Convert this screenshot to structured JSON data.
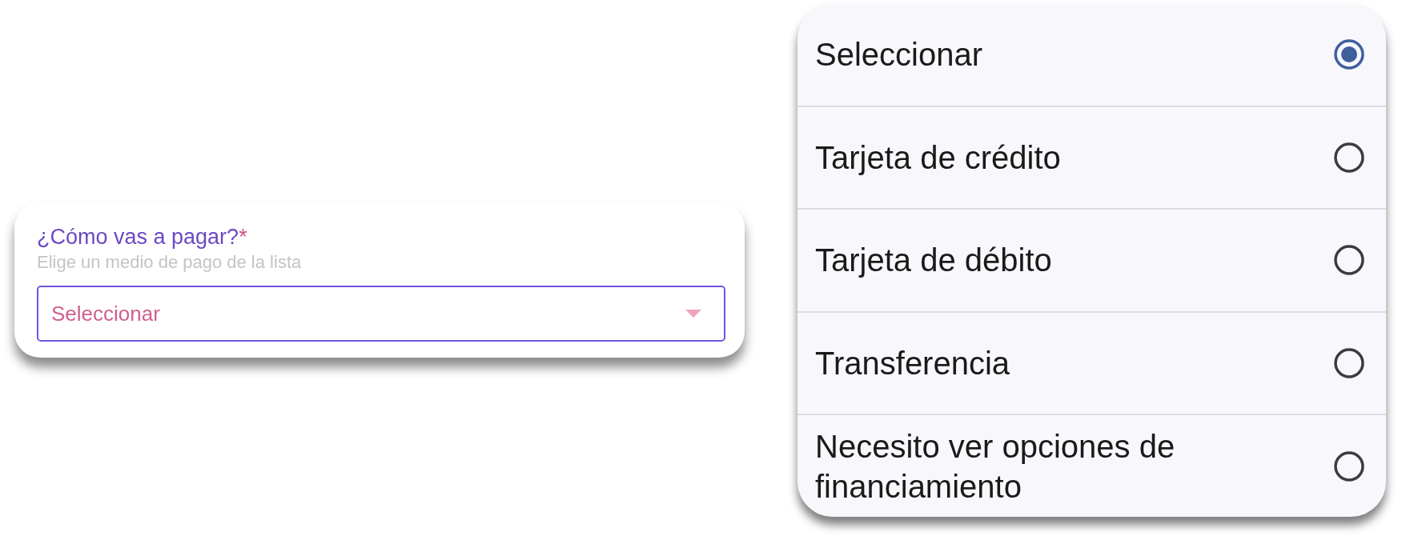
{
  "payment_field": {
    "label": "¿Cómo vas a pagar?",
    "required_mark": "*",
    "hint": "Elige un medio de pago de la lista",
    "select": {
      "value": "Seleccionar"
    }
  },
  "options_list": {
    "options": [
      {
        "label": "Seleccionar",
        "selected": true
      },
      {
        "label": "Tarjeta de crédito",
        "selected": false
      },
      {
        "label": "Tarjeta de débito",
        "selected": false
      },
      {
        "label": "Transferencia",
        "selected": false
      },
      {
        "label": "Necesito ver opciones de financiamiento",
        "selected": false
      }
    ]
  }
}
